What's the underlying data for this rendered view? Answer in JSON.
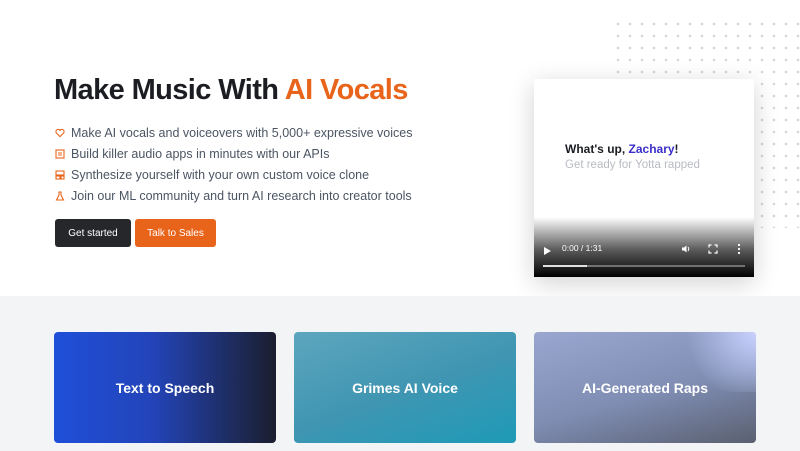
{
  "hero": {
    "title_part1": "Make Music With ",
    "title_accent": "AI Vocals",
    "features": [
      {
        "icon": "heart-icon",
        "text": "Make AI vocals and voiceovers with 5,000+ expressive voices"
      },
      {
        "icon": "code-icon",
        "text": "Build killer audio apps in minutes with our APIs"
      },
      {
        "icon": "clone-icon",
        "text": "Synthesize yourself with your own custom voice clone"
      },
      {
        "icon": "flask-icon",
        "text": "Join our ML community and turn AI research into creator tools"
      }
    ],
    "primary_button": "Get started",
    "secondary_button": "Talk to Sales"
  },
  "video": {
    "greeting": "What's up, ",
    "greeting_name": "Zachary",
    "greeting_end": "!",
    "subline": "Get ready for Yotta rapped",
    "time": "0:00 / 1:31",
    "progress": 0.22
  },
  "cards": [
    {
      "label": "Text to Speech"
    },
    {
      "label": "Grimes AI Voice"
    },
    {
      "label": "AI-Generated Raps"
    }
  ],
  "colors": {
    "accent": "#e8641b",
    "dark_button": "#25272b",
    "name_highlight": "#3b2fc9"
  }
}
